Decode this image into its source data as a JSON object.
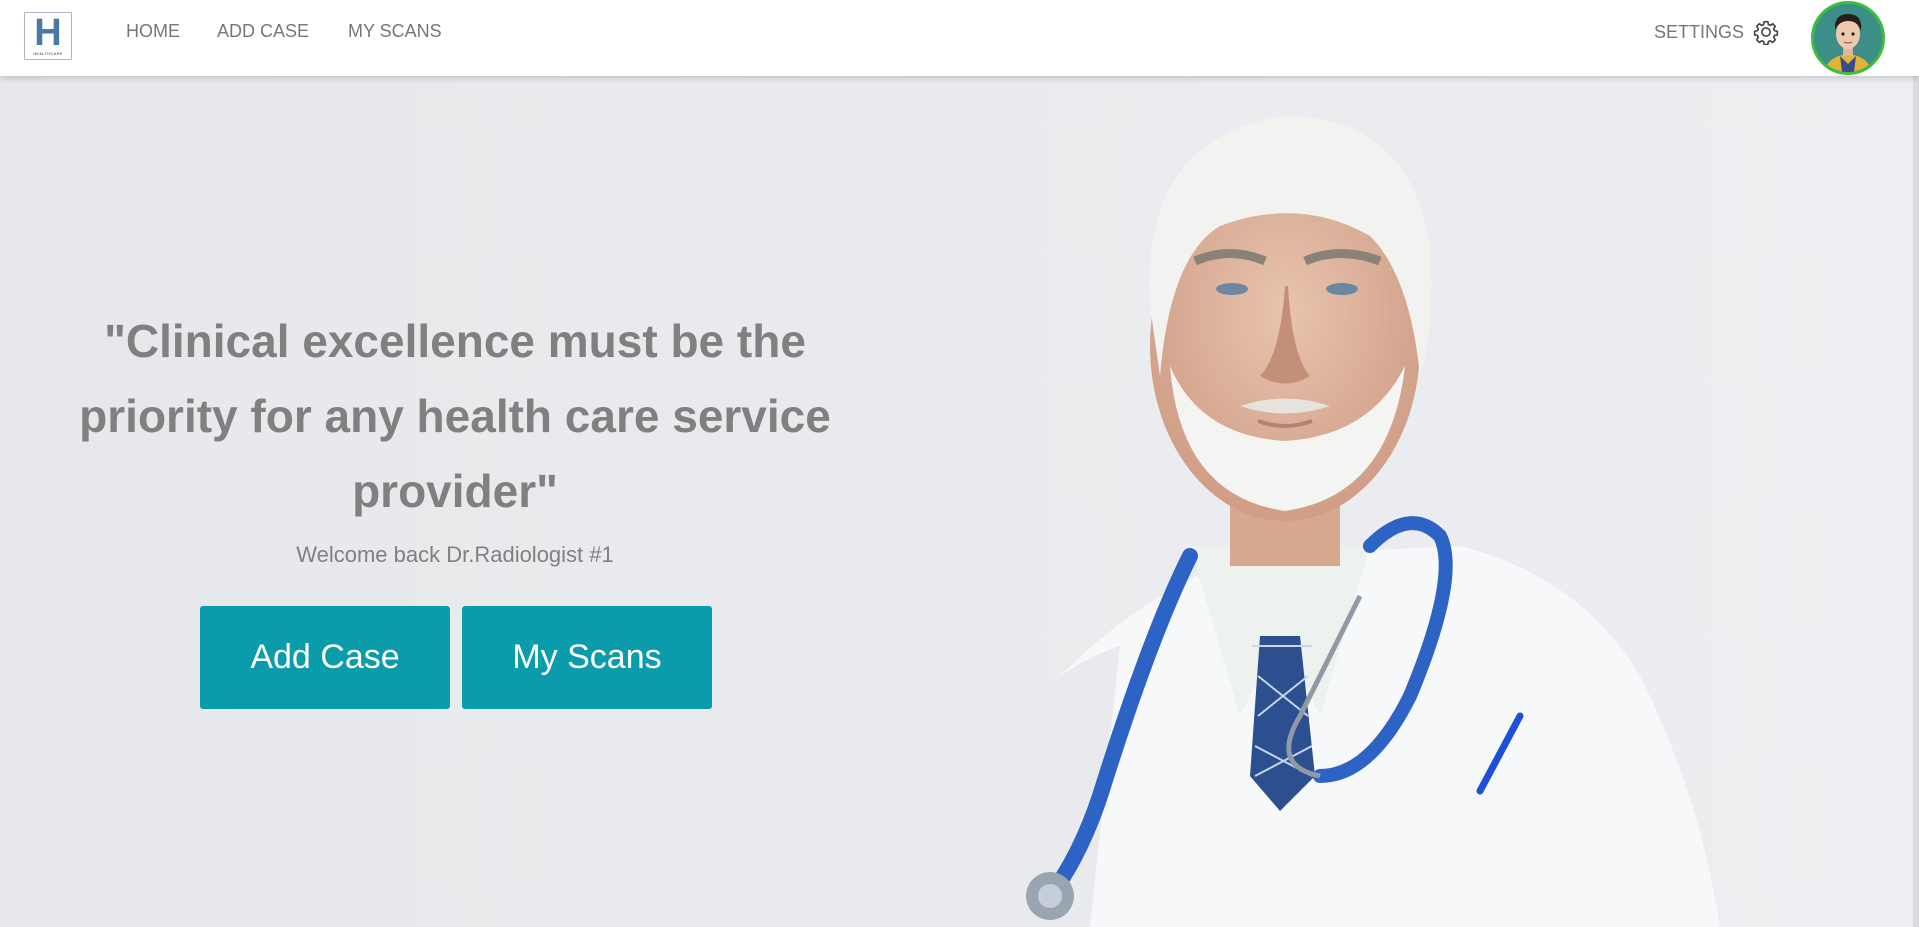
{
  "navbar": {
    "logo": {
      "letter": "H",
      "subtitle": "HEALTHCARE"
    },
    "links": [
      {
        "label": "HOME"
      },
      {
        "label": "ADD CASE"
      },
      {
        "label": "MY SCANS"
      }
    ],
    "settings_label": "SETTINGS",
    "settings_icon": "gear-icon",
    "avatar_icon": "user-avatar"
  },
  "hero": {
    "quote": "\"Clinical excellence must be the priority for any health care service provider\"",
    "welcome": "Welcome back Dr.Radiologist #1",
    "buttons": {
      "add_case": "Add Case",
      "my_scans": "My Scans"
    }
  },
  "colors": {
    "accent": "#0b9cab",
    "text_muted": "#808080",
    "avatar_ring": "#3dbd3d"
  }
}
